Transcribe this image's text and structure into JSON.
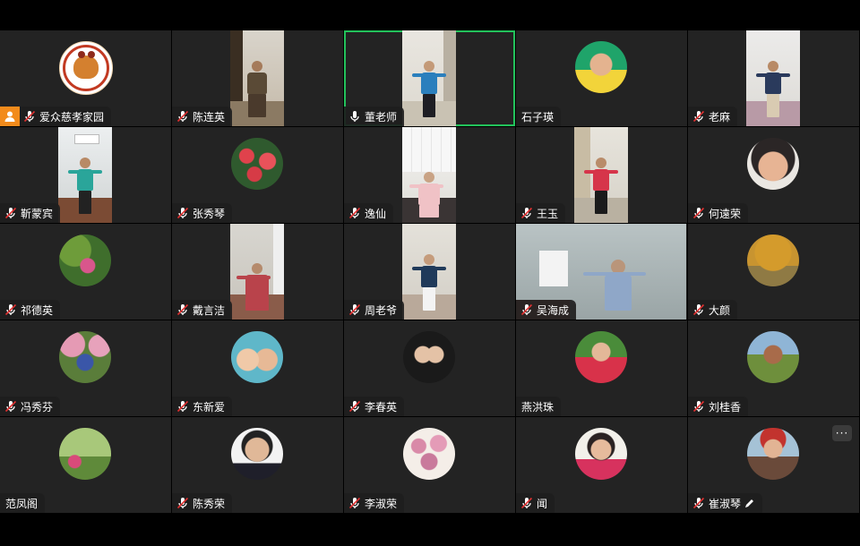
{
  "participants": [
    {
      "name": "爱众慈孝家园",
      "kind": "logo",
      "mic": "muted",
      "badge": true
    },
    {
      "name": "陈连英",
      "kind": "video",
      "mic": "muted"
    },
    {
      "name": "董老师",
      "kind": "video",
      "mic": "on",
      "active": true
    },
    {
      "name": "石子瑛",
      "kind": "avatar",
      "mic": "none"
    },
    {
      "name": "老麻",
      "kind": "video",
      "mic": "muted"
    },
    {
      "name": "靳蒙宾",
      "kind": "video",
      "mic": "muted"
    },
    {
      "name": "张秀琴",
      "kind": "avatar",
      "mic": "muted"
    },
    {
      "name": "逸仙",
      "kind": "video",
      "mic": "muted"
    },
    {
      "name": "王玉",
      "kind": "video",
      "mic": "muted"
    },
    {
      "name": "何遠荣",
      "kind": "avatar",
      "mic": "muted"
    },
    {
      "name": "祁德英",
      "kind": "avatar",
      "mic": "muted"
    },
    {
      "name": "戴言洁",
      "kind": "video",
      "mic": "muted"
    },
    {
      "name": "周老爷",
      "kind": "video",
      "mic": "muted"
    },
    {
      "name": "吴海成",
      "kind": "video-wide",
      "mic": "muted"
    },
    {
      "name": "大颜",
      "kind": "avatar",
      "mic": "muted"
    },
    {
      "name": "冯秀芬",
      "kind": "avatar",
      "mic": "muted"
    },
    {
      "name": "东新爱",
      "kind": "avatar",
      "mic": "muted"
    },
    {
      "name": "李春英",
      "kind": "avatar",
      "mic": "muted"
    },
    {
      "name": "燕洪珠",
      "kind": "avatar",
      "mic": "none"
    },
    {
      "name": "刘桂香",
      "kind": "avatar",
      "mic": "muted"
    },
    {
      "name": "范凤阁",
      "kind": "avatar",
      "mic": "none"
    },
    {
      "name": "陈秀荣",
      "kind": "avatar",
      "mic": "muted"
    },
    {
      "name": "李淑荣",
      "kind": "avatar",
      "mic": "muted"
    },
    {
      "name": "闻",
      "kind": "avatar",
      "mic": "muted"
    },
    {
      "name": "崔淑琴",
      "kind": "avatar",
      "mic": "muted",
      "editing": true,
      "more": true
    }
  ],
  "more_label": "···",
  "colors": {
    "tile_bg": "#232323",
    "active_border": "#23c25b",
    "badge": "#f28b1c",
    "muted_mic": "#ffffff"
  }
}
